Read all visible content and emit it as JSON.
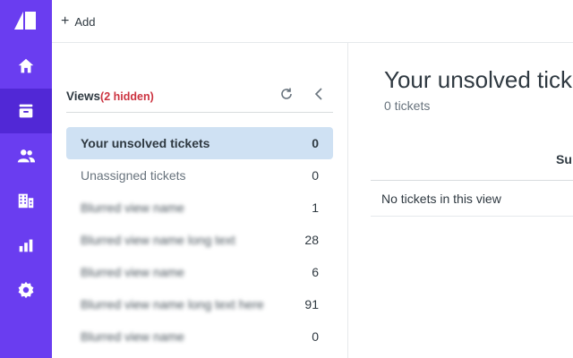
{
  "rail": {
    "items": [
      {
        "icon": "home-icon"
      },
      {
        "icon": "inbox-icon",
        "active": true
      },
      {
        "icon": "users-icon"
      },
      {
        "icon": "organizations-icon"
      },
      {
        "icon": "reports-icon"
      },
      {
        "icon": "gear-icon"
      }
    ],
    "brand_color": "#6a3df0"
  },
  "topbar": {
    "add_label": "Add"
  },
  "views": {
    "title": "Views",
    "hidden_note": "(2 hidden)",
    "items": [
      {
        "label": "Your unsolved tickets",
        "count": "0",
        "selected": true
      },
      {
        "label": "Unassigned tickets",
        "count": "0"
      },
      {
        "label": "Blurred view name",
        "count": "1",
        "obscured": true
      },
      {
        "label": "Blurred view name long text",
        "count": "28",
        "obscured": true
      },
      {
        "label": "Blurred view name",
        "count": "6",
        "obscured": true
      },
      {
        "label": "Blurred view name long text here",
        "count": "91",
        "obscured": true
      },
      {
        "label": "Blurred view name",
        "count": "0",
        "obscured": true
      }
    ]
  },
  "main": {
    "title": "Your unsolved tickets",
    "subtitle": "0 tickets",
    "column_header": "Su",
    "empty_message": "No tickets in this view"
  }
}
